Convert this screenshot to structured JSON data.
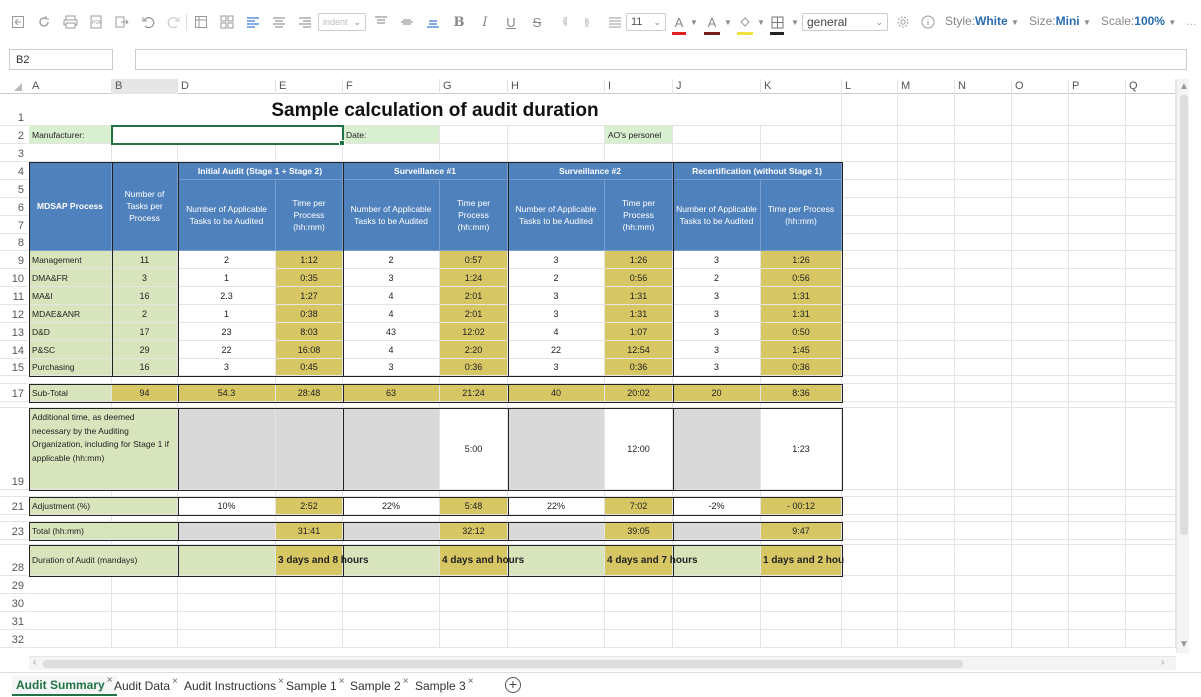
{
  "toolbar": {
    "font_size": "11",
    "indent_placeholder": "indent",
    "format_value": "general",
    "style_label": "Style:",
    "style_value": "White",
    "size_label": "Size:",
    "size_value": "Mini",
    "scale_label": "Scale:",
    "scale_value": "100%",
    "more": "...",
    "font_color": "#e02020",
    "highlight_color": "#7a1f1f",
    "fill_color": "#f0e040",
    "border_color": "#222222"
  },
  "namebox": "B2",
  "columns": [
    "A",
    "B",
    "D",
    "E",
    "F",
    "G",
    "H",
    "I",
    "J",
    "K",
    "L",
    "M",
    "N",
    "O",
    "P",
    "Q"
  ],
  "rows": [
    "1",
    "2",
    "3",
    "4",
    "5",
    "6",
    "7",
    "8",
    "9",
    "10",
    "11",
    "12",
    "13",
    "14",
    "15",
    "16",
    "17",
    "18",
    "19",
    "20",
    "21",
    "22",
    "23",
    "24",
    "28",
    "29",
    "30",
    "31",
    "32"
  ],
  "sheet": {
    "title": "Sample calculation of audit duration",
    "manufacturer_label": "Manufacturer:",
    "date_label": "Date:",
    "ao_label": "AO's personel",
    "headers": {
      "process": "MDSAP Process",
      "tasks_per_process": "Number of Tasks per Process",
      "initial": "Initial Audit (Stage 1 + Stage 2)",
      "surv1": "Surveillance #1",
      "surv2": "Surveillance #2",
      "recert": "Recertification (without Stage 1)",
      "applicable": "Number of Applicable Tasks to be Audited",
      "time": "Time per Process (hh:mm)"
    },
    "process_rows": [
      {
        "name": "Management",
        "tasks": "11",
        "d": "2",
        "e": "1:12",
        "f": "2",
        "g": "0:57",
        "h": "3",
        "i": "1:26",
        "j": "3",
        "k": "1:26"
      },
      {
        "name": "DMA&FR",
        "tasks": "3",
        "d": "1",
        "e": "0:35",
        "f": "3",
        "g": "1:24",
        "h": "2",
        "i": "0:56",
        "j": "2",
        "k": "0:56"
      },
      {
        "name": "MA&I",
        "tasks": "16",
        "d": "2.3",
        "e": "1:27",
        "f": "4",
        "g": "2:01",
        "h": "3",
        "i": "1:31",
        "j": "3",
        "k": "1:31"
      },
      {
        "name": "MDAE&ANR",
        "tasks": "2",
        "d": "1",
        "e": "0:38",
        "f": "4",
        "g": "2:01",
        "h": "3",
        "i": "1:31",
        "j": "3",
        "k": "1:31"
      },
      {
        "name": "D&D",
        "tasks": "17",
        "d": "23",
        "e": "8:03",
        "f": "43",
        "g": "12:02",
        "h": "4",
        "i": "1:07",
        "j": "3",
        "k": "0:50"
      },
      {
        "name": "P&SC",
        "tasks": "29",
        "d": "22",
        "e": "16:08",
        "f": "4",
        "g": "2:20",
        "h": "22",
        "i": "12:54",
        "j": "3",
        "k": "1:45"
      },
      {
        "name": "Purchasing",
        "tasks": "16",
        "d": "3",
        "e": "0:45",
        "f": "3",
        "g": "0:36",
        "h": "3",
        "i": "0:36",
        "j": "3",
        "k": "0:36"
      }
    ],
    "subtotal": {
      "label": "Sub-Total",
      "b": "94",
      "d": "54.3",
      "e": "28:48",
      "f": "63",
      "g": "21:24",
      "h": "40",
      "i": "20:02",
      "j": "20",
      "k": "8:36"
    },
    "additional": {
      "label": "Additional time, as deemed necessary by the Auditing Organization, including for Stage 1 if applicable (hh:mm)",
      "g": "5:00",
      "i": "12:00",
      "k": "1:23"
    },
    "adjustment": {
      "label": "Adjustment (%)",
      "d": "10%",
      "e": "2:52",
      "f": "22%",
      "g": "5:48",
      "h": "22%",
      "i": "7:02",
      "j": "-2%",
      "k": "- 00:12"
    },
    "total": {
      "label": "Total (hh:mm)",
      "e": "31:41",
      "g": "32:12",
      "i": "39:05",
      "k": "9:47"
    },
    "duration": {
      "label": "Duration of Audit (mandays)",
      "e": "3 days and 8 hours",
      "g": "4 days and  hours",
      "i": "4 days and 7 hours",
      "k": "1 days and 2 hou"
    }
  },
  "tabs": [
    "Audit Summary",
    "Audit Data",
    "Audit Instructions",
    "Sample 1",
    "Sample 2",
    "Sample 3"
  ],
  "tab_close": "×",
  "add_tab": "+"
}
